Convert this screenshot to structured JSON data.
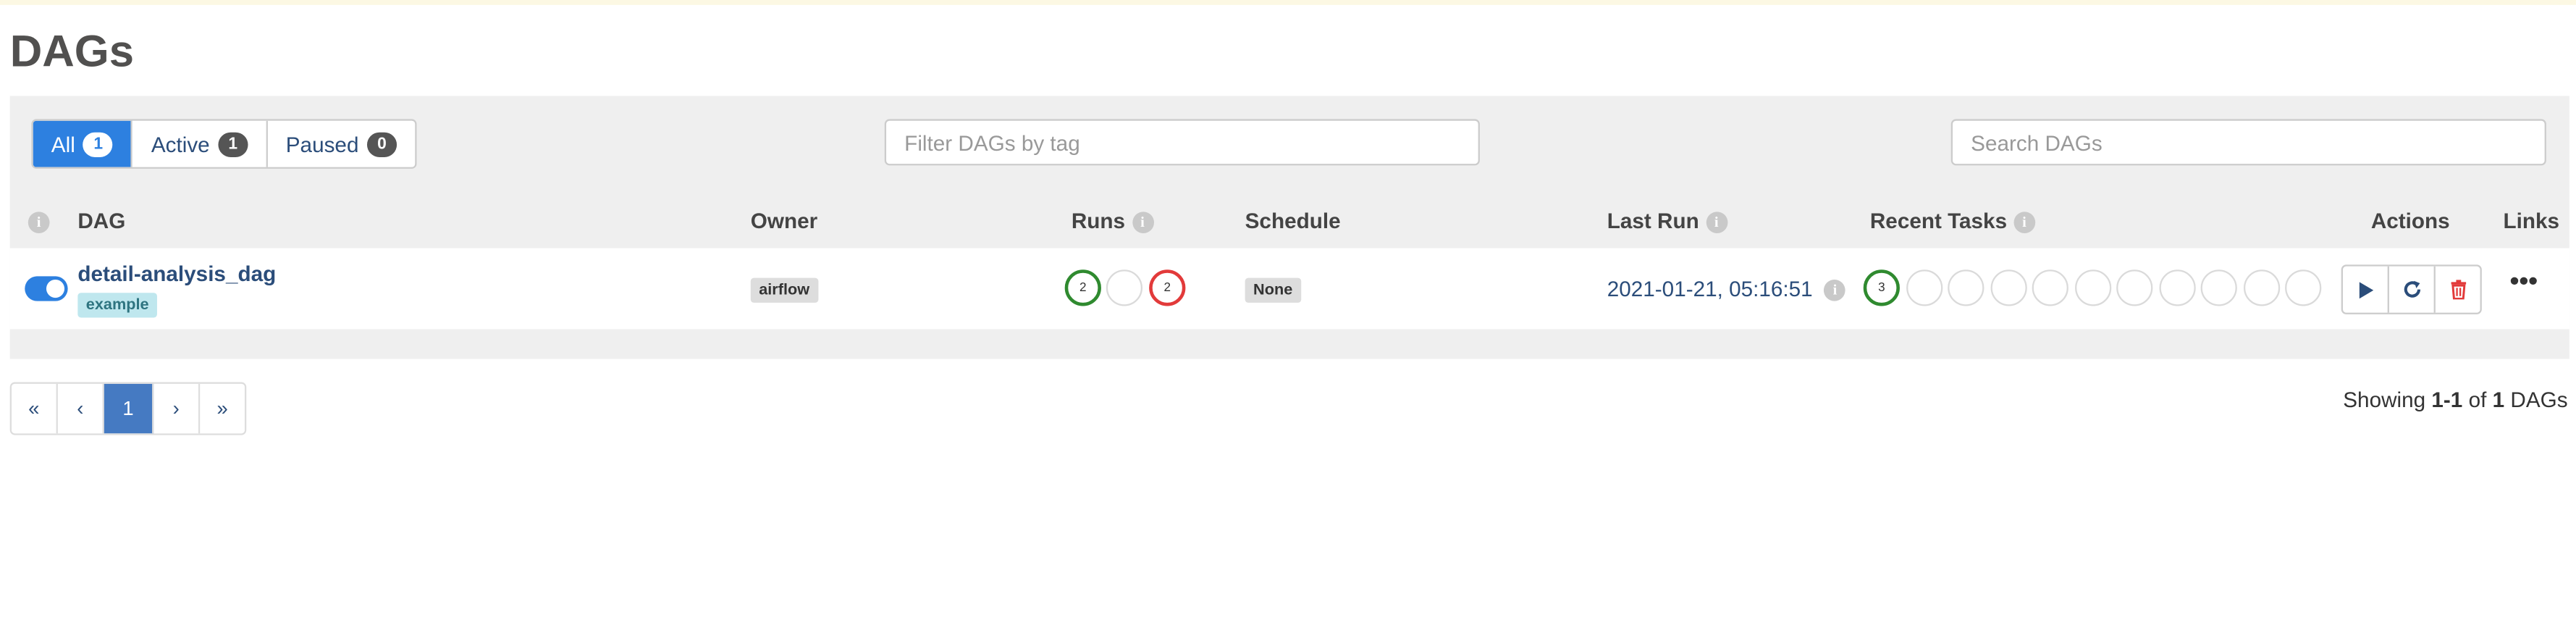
{
  "page": {
    "title": "DAGs"
  },
  "status_filter": {
    "tabs": [
      {
        "label": "All",
        "count": "1",
        "active": true
      },
      {
        "label": "Active",
        "count": "1",
        "active": false
      },
      {
        "label": "Paused",
        "count": "0",
        "active": false
      }
    ]
  },
  "filters": {
    "tag_placeholder": "Filter DAGs by tag",
    "search_placeholder": "Search DAGs"
  },
  "table": {
    "headers": {
      "dag": "DAG",
      "owner": "Owner",
      "runs": "Runs",
      "schedule": "Schedule",
      "last_run": "Last Run",
      "recent_tasks": "Recent Tasks",
      "actions": "Actions",
      "links": "Links"
    },
    "rows": [
      {
        "enabled": true,
        "dag_id": "detail-analysis_dag",
        "tag": "example",
        "owner": "airflow",
        "runs": [
          {
            "state": "success",
            "count": "2"
          },
          {
            "state": "running",
            "count": ""
          },
          {
            "state": "failed",
            "count": "2"
          }
        ],
        "schedule": "None",
        "last_run": "2021-01-21, 05:16:51",
        "recent_tasks": [
          "3",
          "",
          "",
          "",
          "",
          "",
          "",
          "",
          "",
          "",
          ""
        ]
      }
    ]
  },
  "icons": {
    "info": "info-icon",
    "trigger": "play-icon",
    "refresh": "refresh-icon",
    "delete": "trash-icon",
    "links": "more-icon"
  },
  "colors": {
    "accent": "#2d80e0",
    "success": "#2f8a2f",
    "failed": "#e23a3a",
    "delete": "#e23a3a"
  },
  "pagination": {
    "first": "«",
    "prev": "‹",
    "current": "1",
    "next": "›",
    "last": "»"
  },
  "summary": {
    "prefix": "Showing ",
    "range": "1-1",
    "of": " of ",
    "total": "1",
    "suffix": " DAGs"
  }
}
